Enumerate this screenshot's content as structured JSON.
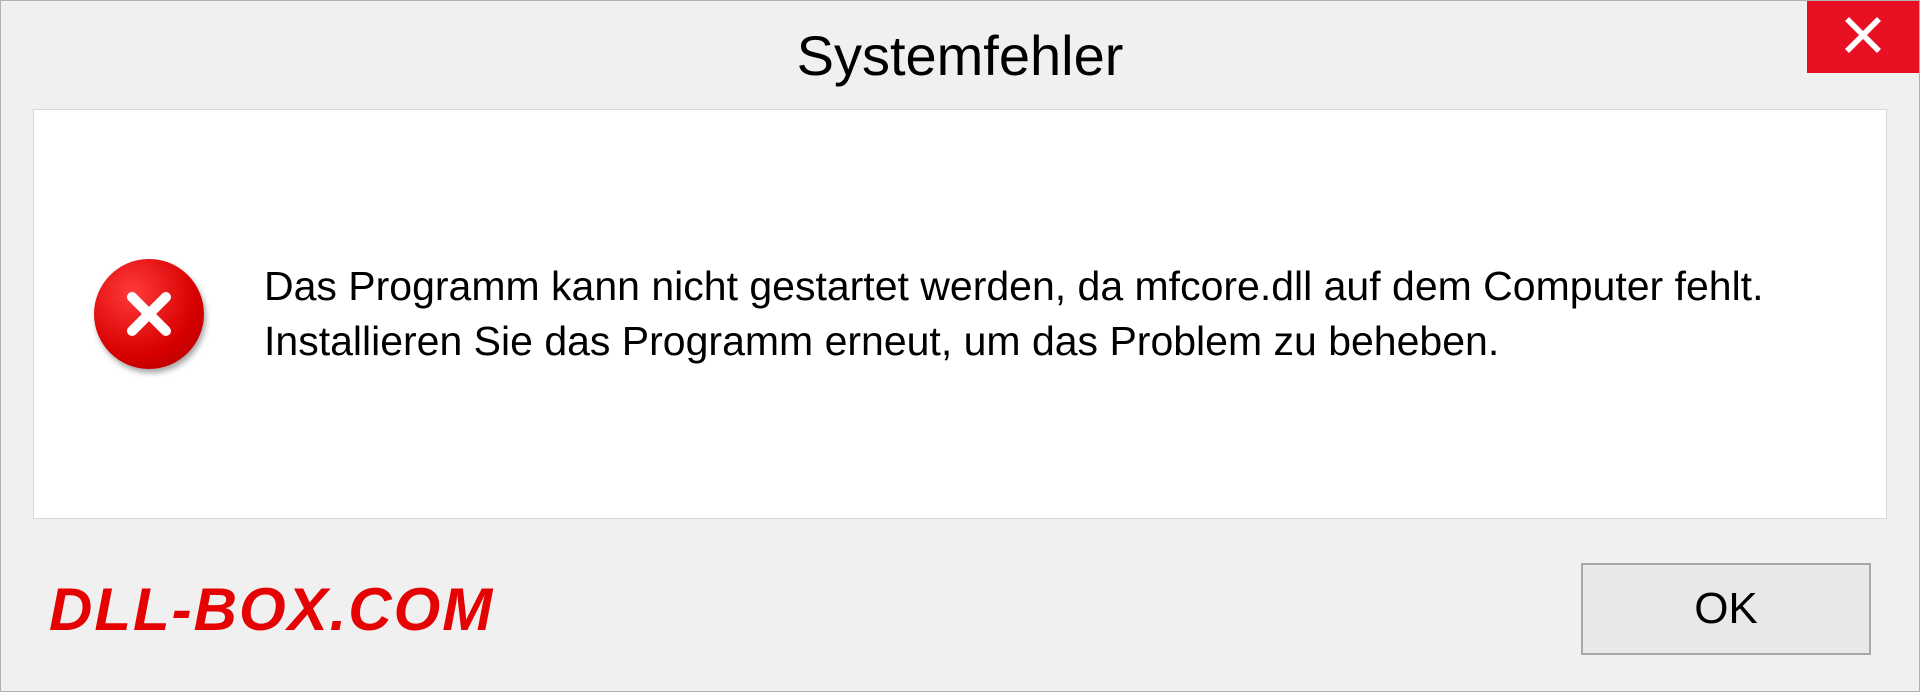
{
  "dialog": {
    "title": "Systemfehler",
    "message": "Das Programm kann nicht gestartet werden, da mfcore.dll auf dem Computer fehlt. Installieren Sie das Programm erneut, um das Problem zu beheben.",
    "ok_label": "OK",
    "watermark": "DLL-BOX.COM"
  },
  "colors": {
    "close_button": "#e81123",
    "error_red": "#d80000",
    "watermark_red": "#e40202"
  }
}
